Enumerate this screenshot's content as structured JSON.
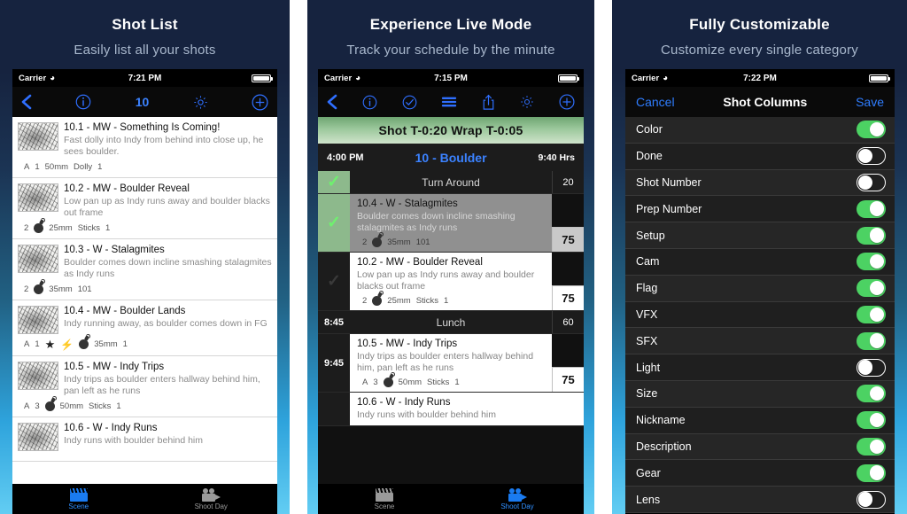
{
  "panels": [
    {
      "headline": "Shot List",
      "subhead": "Easily list all your shots",
      "status": {
        "carrier": "Carrier",
        "time": "7:21 PM"
      },
      "navbar": {
        "title": "10"
      },
      "tabs": {
        "left": "Scene",
        "right": "Shoot Day"
      },
      "shots": [
        {
          "title": "10.1 - MW - Something Is Coming!",
          "desc": "Fast dolly into Indy from behind into close up, he sees boulder.",
          "meta": [
            "A",
            "1",
            "50mm",
            "Dolly",
            "1"
          ],
          "icons": []
        },
        {
          "title": "10.2 - MW - Boulder Reveal",
          "desc": "Low pan up as Indy runs away and boulder blacks out frame",
          "meta": [
            "2",
            "25mm",
            "Sticks",
            "1"
          ],
          "icons": [
            "bomb-icon"
          ]
        },
        {
          "title": "10.3 - W - Stalagmites",
          "desc": "Boulder comes down incline smashing stalagmites as Indy runs",
          "meta": [
            "2",
            "35mm",
            "101"
          ],
          "icons": [
            "bomb-icon"
          ]
        },
        {
          "title": "10.4 - MW - Boulder Lands",
          "desc": "Indy running away, as boulder comes down in FG",
          "meta": [
            "A",
            "1",
            "35mm",
            "1"
          ],
          "icons": [
            "star-icon",
            "bolt-icon",
            "bomb-icon"
          ]
        },
        {
          "title": "10.5 - MW - Indy Trips",
          "desc": "Indy trips as boulder enters hallway behind him, pan left as he runs",
          "meta": [
            "A",
            "3",
            "50mm",
            "Sticks",
            "1"
          ],
          "icons": [
            "bomb-icon"
          ]
        },
        {
          "title": "10.6 - W - Indy Runs",
          "desc": "Indy runs with boulder behind him",
          "meta": [],
          "icons": []
        }
      ]
    },
    {
      "headline": "Experience Live Mode",
      "subhead": "Track your schedule by the minute",
      "status": {
        "carrier": "Carrier",
        "time": "7:15 PM"
      },
      "timer": "Shot T-0:20  Wrap T-0:05",
      "day": {
        "start": "4:00 PM",
        "title": "10 - Boulder",
        "hours": "9:40 Hrs"
      },
      "tabs": {
        "left": "Scene",
        "right": "Shoot Day"
      },
      "rows": [
        {
          "kind": "break",
          "gutter": "check-on",
          "label": "Turn Around",
          "duration": "20"
        },
        {
          "kind": "shot",
          "gutter": "check-on",
          "state": "grey",
          "title": "10.4 - W - Stalagmites",
          "desc": "Boulder comes down incline smashing stalagmites as Indy runs",
          "meta": [
            "2",
            "35mm",
            "101"
          ],
          "icons": [
            "bomb-icon"
          ],
          "points": "75"
        },
        {
          "kind": "shot",
          "gutter": "check-off",
          "state": "white",
          "title": "10.2 - MW - Boulder Reveal",
          "desc": "Low pan up as Indy runs away and boulder blacks out frame",
          "meta": [
            "2",
            "25mm",
            "Sticks",
            "1"
          ],
          "icons": [
            "bomb-icon"
          ],
          "points": "75"
        },
        {
          "kind": "break",
          "gutter": "8:45",
          "label": "Lunch",
          "duration": "60"
        },
        {
          "kind": "shot",
          "gutter": "9:45",
          "state": "white",
          "title": "10.5 - MW - Indy Trips",
          "desc": "Indy trips as boulder enters hallway behind him, pan left as he runs",
          "meta": [
            "A",
            "3",
            "50mm",
            "Sticks",
            "1"
          ],
          "icons": [
            "bomb-icon"
          ],
          "points": "75"
        },
        {
          "kind": "shot",
          "gutter": "",
          "state": "white",
          "title": "10.6 - W - Indy Runs",
          "desc": "Indy runs with boulder behind him",
          "meta": [],
          "icons": [],
          "points": ""
        }
      ]
    },
    {
      "headline": "Fully Customizable",
      "subhead": "Customize every single category",
      "status": {
        "carrier": "Carrier",
        "time": "7:22 PM"
      },
      "navbar": {
        "cancel": "Cancel",
        "title": "Shot Columns",
        "save": "Save"
      },
      "settings": [
        {
          "label": "Color",
          "on": true
        },
        {
          "label": "Done",
          "on": false
        },
        {
          "label": "Shot Number",
          "on": false
        },
        {
          "label": "Prep Number",
          "on": true
        },
        {
          "label": "Setup",
          "on": true
        },
        {
          "label": "Cam",
          "on": true
        },
        {
          "label": "Flag",
          "on": true
        },
        {
          "label": "VFX",
          "on": true
        },
        {
          "label": "SFX",
          "on": true
        },
        {
          "label": "Light",
          "on": false
        },
        {
          "label": "Size",
          "on": true
        },
        {
          "label": "Nickname",
          "on": true
        },
        {
          "label": "Description",
          "on": true
        },
        {
          "label": "Gear",
          "on": true
        },
        {
          "label": "Lens",
          "on": false
        }
      ]
    }
  ],
  "colors": {
    "accent_blue": "#3b82ff",
    "toggle_green": "#4cd263",
    "banner_green": "#9cc89c",
    "bg_top": "#16233f",
    "bg_bottom": "#62cdf3"
  }
}
